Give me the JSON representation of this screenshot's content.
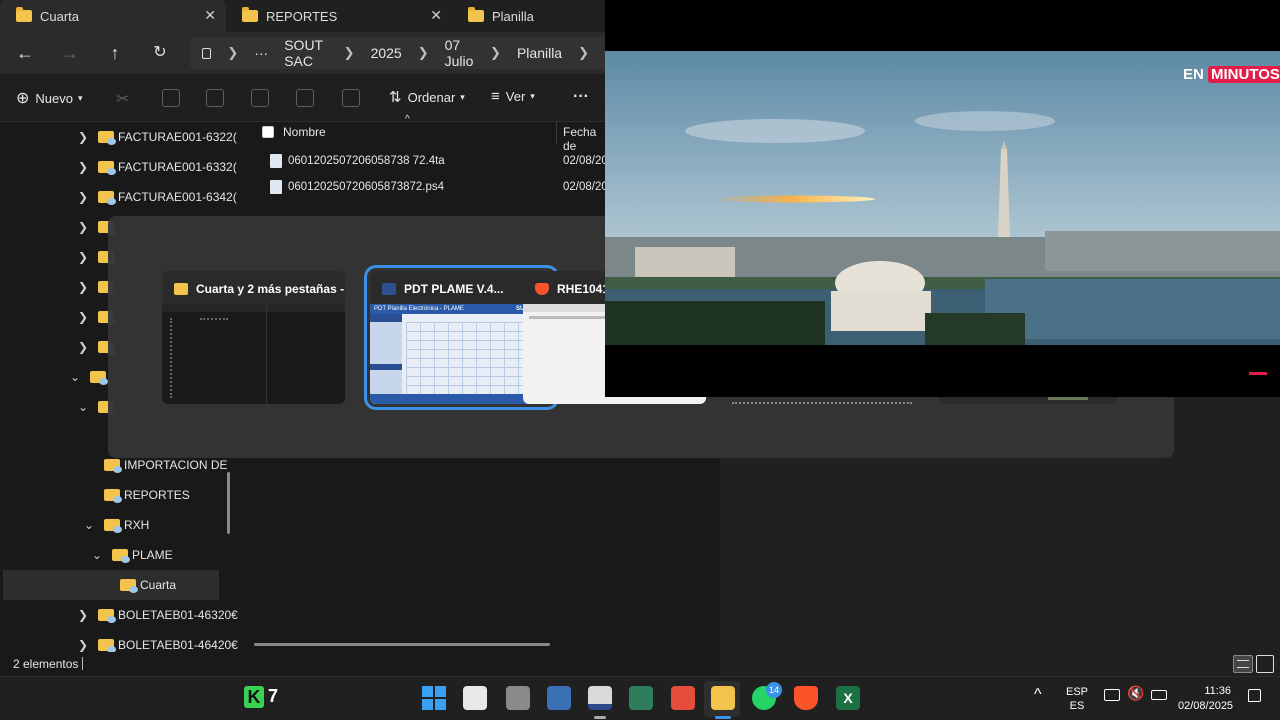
{
  "tabs": [
    {
      "label": "Cuarta",
      "active": true
    },
    {
      "label": "REPORTES",
      "active": false
    },
    {
      "label": "Planilla",
      "active": false
    }
  ],
  "nav": {
    "back_icon": "arrow-left-icon",
    "forward_icon": "arrow-right-icon",
    "up_icon": "arrow-up-icon",
    "refresh_icon": "refresh-icon",
    "breadcrumb": [
      "SOUT SAC",
      "2025",
      "07 Julio",
      "Planilla"
    ],
    "ellipsis": "···"
  },
  "toolbar": {
    "new_label": "Nuevo",
    "sort_label": "Ordenar",
    "view_label": "Ver",
    "more_label": "···"
  },
  "sidebar": {
    "items": [
      {
        "label": "FACTURAE001-6322("
      },
      {
        "label": "FACTURAE001-6332("
      },
      {
        "label": "FACTURAE001-6342("
      },
      {
        "label": "IMPORTACION DE"
      },
      {
        "label": "REPORTES"
      },
      {
        "label": "RXH"
      },
      {
        "label": "PLAME"
      },
      {
        "label": "Cuarta"
      },
      {
        "label": "BOLETAEB01-46320€"
      },
      {
        "label": "BOLETAEB01-46420€"
      }
    ]
  },
  "filelist": {
    "col_name": "Nombre",
    "col_date": "Fecha de",
    "rows": [
      {
        "name": "0601202507206058738 72.4ta",
        "date": "02/08/2025"
      },
      {
        "name": "060120250720605873872.ps4",
        "date": "02/08/2025"
      }
    ]
  },
  "status": {
    "count": "2 elementos"
  },
  "switcher": {
    "cards": [
      {
        "title": "Cuarta y 2 más pestañas -..."
      },
      {
        "title": "PDT PLAME V.4..."
      },
      {
        "title": "RHE104110"
      }
    ],
    "pdt_header": "PDT Planilla Electrónica - PLAME",
    "pdt_brand": "SUNAT"
  },
  "video": {
    "badge_en": "EN",
    "badge_minutos": "MINUTOS"
  },
  "taskbar": {
    "k_label": "7",
    "whatsapp_badge": "14",
    "lang_top": "ESP",
    "lang_bottom": "ES",
    "time": "11:36",
    "date": "02/08/2025"
  },
  "colors": {
    "accent": "#3b91e6",
    "folder": "#f3c44c",
    "badge": "#e11d48"
  }
}
